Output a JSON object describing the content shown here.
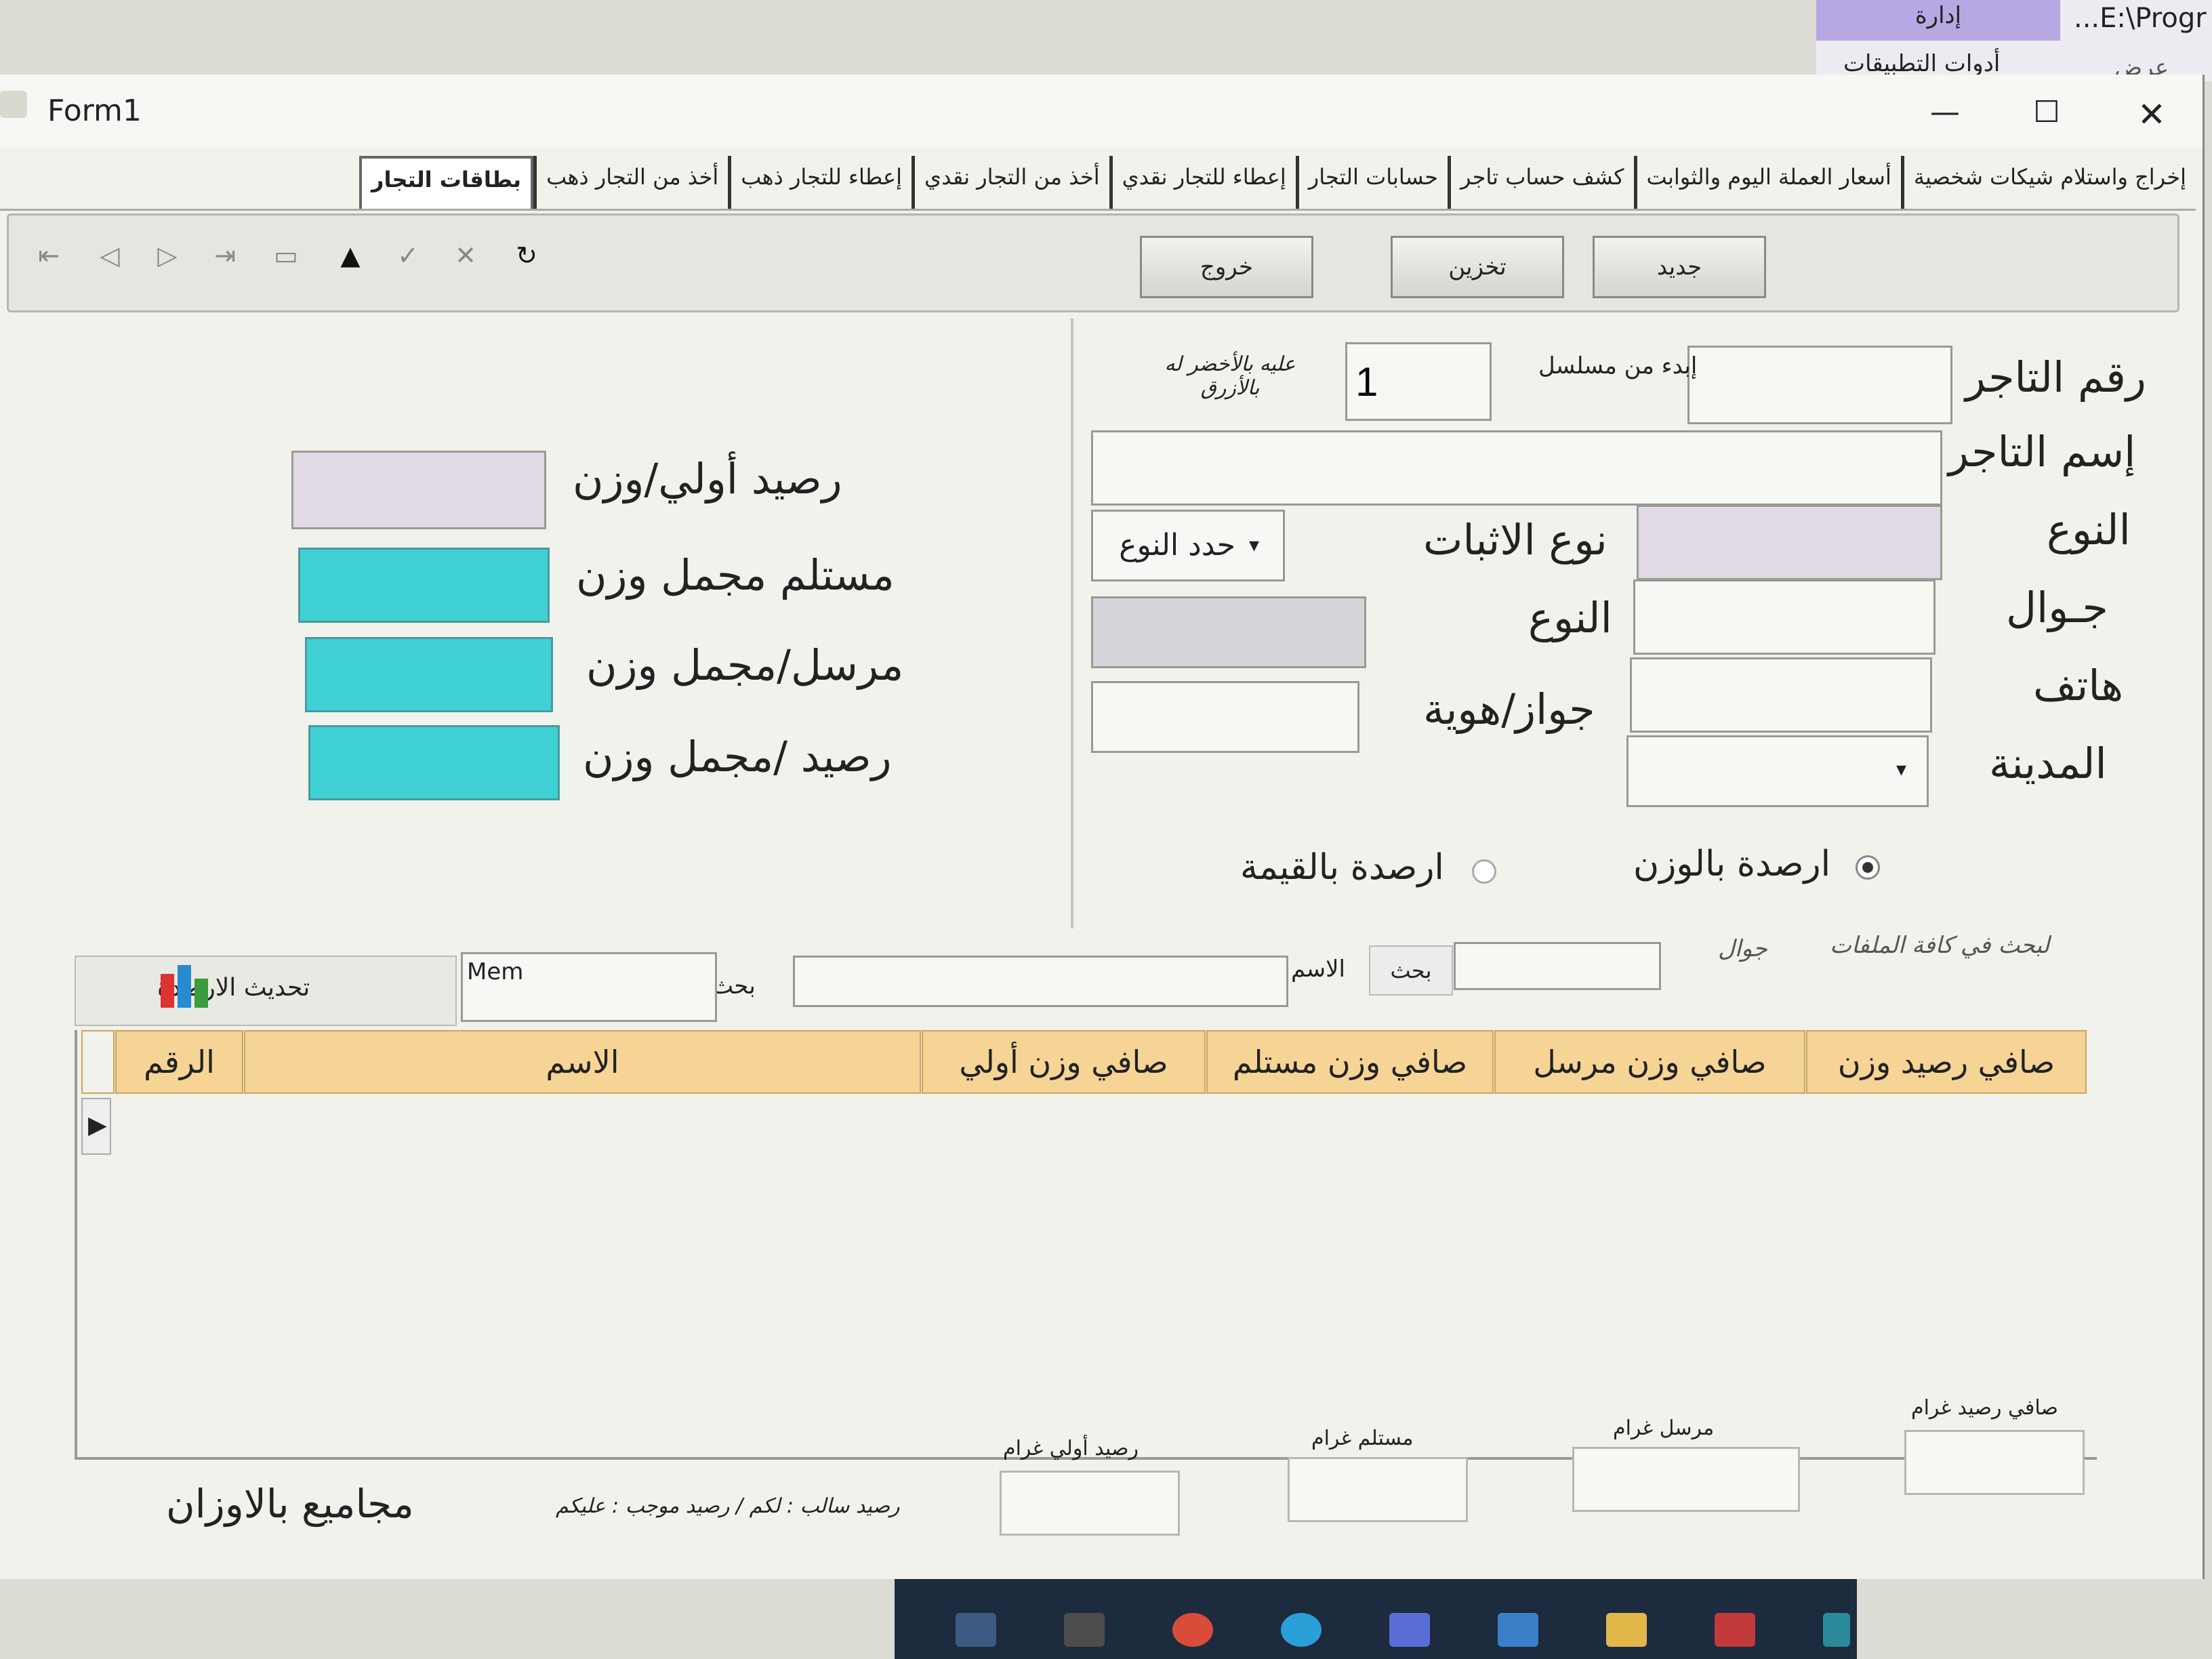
{
  "external": {
    "admin_tab": "إدارة",
    "path": "...E:\\Progr",
    "tools": "أدوات التطبيقات",
    "view": "عرض"
  },
  "window": {
    "title": "Form1",
    "min": "—",
    "max": "☐",
    "close": "✕"
  },
  "tabs": [
    "بطاقات التجار",
    "أخذ من التجار ذهب",
    "إعطاء للتجار ذهب",
    "أخذ من التجار نقدي",
    "إعطاء للتجار نقدي",
    "حسابات التجار",
    "كشف حساب تاجر",
    "أسعار العملة اليوم والثوابت",
    "إخراج واستلام شيكات شخصية"
  ],
  "toolbar": {
    "new": "جديد",
    "save": "تخزين",
    "exit": "خروج"
  },
  "form": {
    "merchant_no": "رقم التاجر",
    "start_serial": "إبدء من مسلسل",
    "serial_value": "1",
    "note": "عليه بالأخضر له بالأزرق",
    "merchant_name": "إسم التاجر",
    "type": "النوع",
    "id_type": "نوع الاثبات",
    "choose_type": "حدد النوع",
    "mobile": "جـوال",
    "type2": "النوع",
    "phone": "هاتف",
    "passport": "جواز/هوية",
    "city": "المدينة",
    "radio_weight": "ارصدة بالوزن",
    "radio_value": "ارصدة بالقيمة"
  },
  "left": {
    "initial_balance": "رصيد أولي/وزن",
    "received": "مستلم مجمل وزن",
    "sent": "مرسل/مجمل وزن",
    "balance": "رصيد /مجمل وزن"
  },
  "search": {
    "all_files": "لبحث في كافة الملفات",
    "mobile": "جوال",
    "search_btn": "بحث",
    "name": "الاسم",
    "search2": "بحث",
    "mem": "Mem",
    "refresh": "تحديث الارصدة"
  },
  "grid": {
    "columns": [
      "الرقم",
      "الاسم",
      "صافي وزن أولي",
      "صافي وزن مستلم",
      "صافي وزن مرسل",
      "صافي رصيد وزن"
    ]
  },
  "footer": {
    "net_balance_g": "صافي رصيد غرام",
    "sent_g": "مرسل غرام",
    "received_g": "مستلم غرام",
    "initial_g": "رصيد أولي غرام",
    "legend": "رصيد سالب : لكم / رصيد موجب : عليكم",
    "totals": "مجاميع بالاوزان"
  }
}
